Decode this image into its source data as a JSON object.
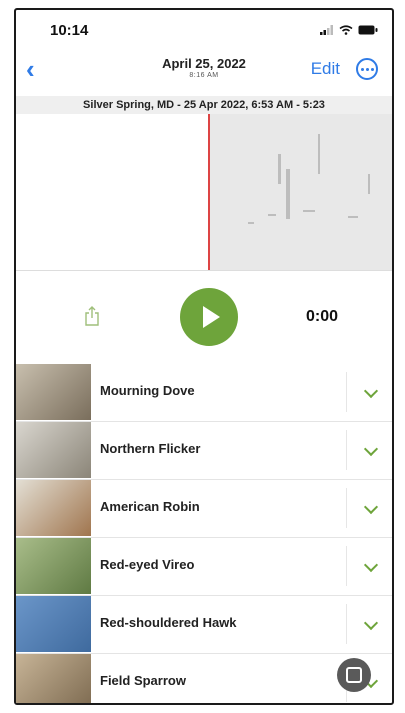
{
  "status": {
    "time": "10:14"
  },
  "nav": {
    "title": "April 25, 2022",
    "subtitle": "8:16 AM",
    "edit_label": "Edit"
  },
  "location_bar": "Silver Spring, MD - 25 Apr 2022, 6:53 AM - 5:23",
  "player": {
    "elapsed": "0:00"
  },
  "species": [
    {
      "name": "Mourning Dove",
      "thumb_color": "#8c7e6a"
    },
    {
      "name": "Northern Flicker",
      "thumb_color": "#b9b4a8"
    },
    {
      "name": "American Robin",
      "thumb_color": "#c9c3b2"
    },
    {
      "name": "Red-eyed Vireo",
      "thumb_color": "#7f9a62"
    },
    {
      "name": "Red-shouldered Hawk",
      "thumb_color": "#5d86b8"
    },
    {
      "name": "Field Sparrow",
      "thumb_color": "#a48d6f"
    }
  ],
  "colors": {
    "accent_blue": "#2f7be6",
    "accent_green": "#6ea43b"
  }
}
